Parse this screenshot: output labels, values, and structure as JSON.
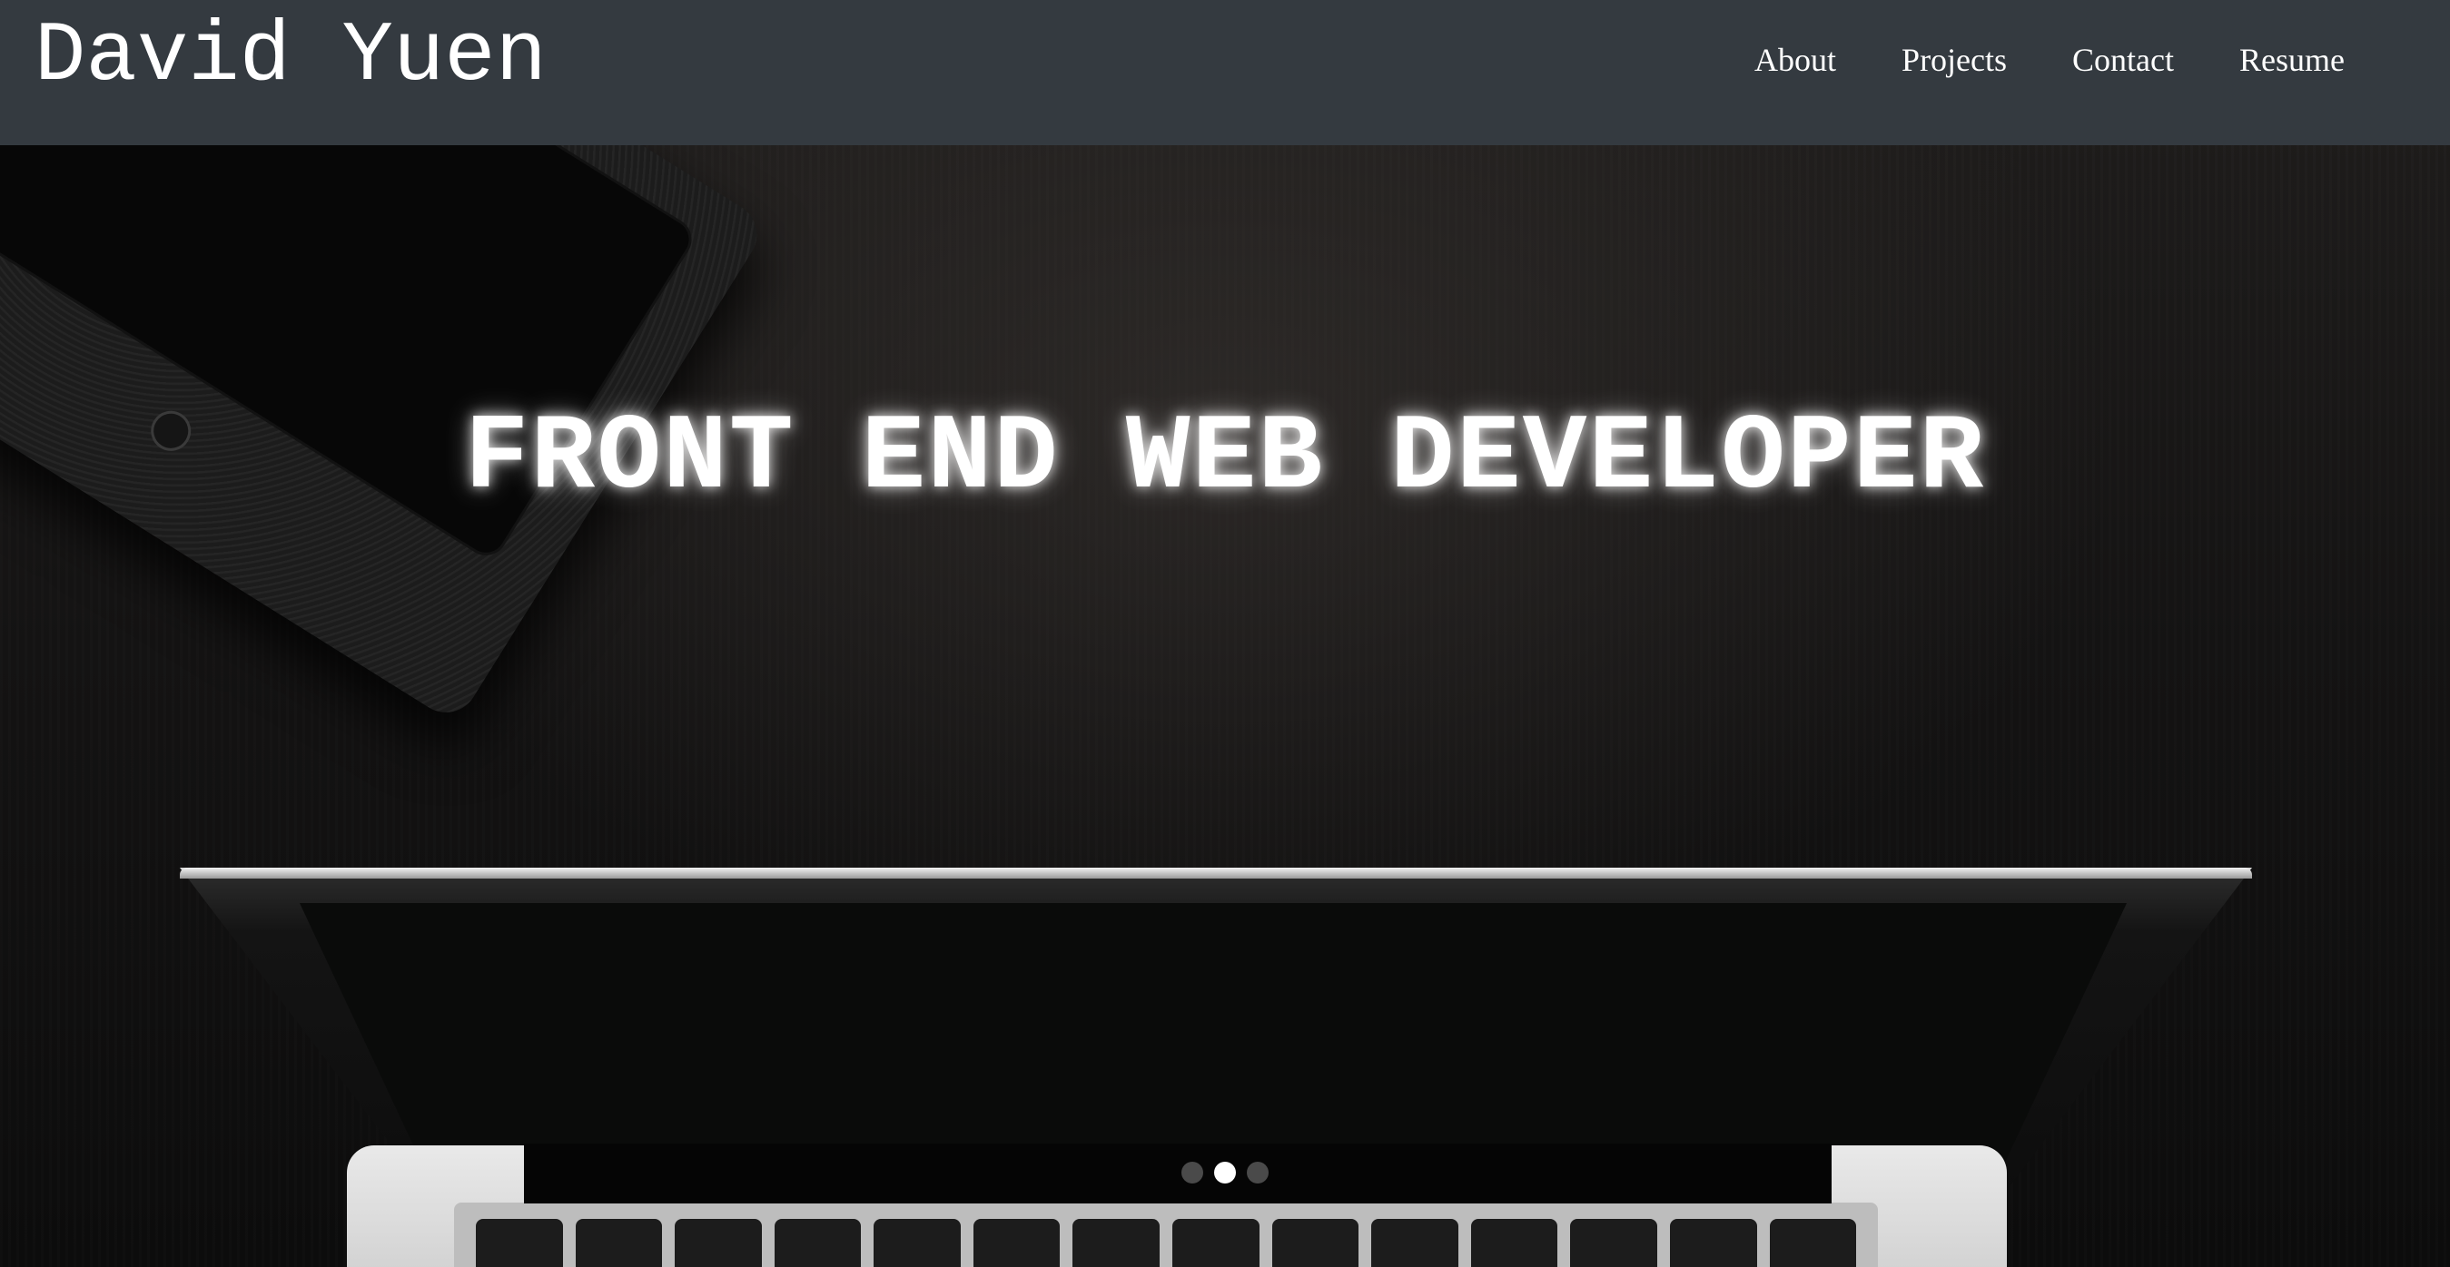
{
  "header": {
    "brand": "David Yuen",
    "nav": [
      {
        "label": "About"
      },
      {
        "label": "Projects"
      },
      {
        "label": "Contact"
      },
      {
        "label": "Resume"
      }
    ]
  },
  "hero": {
    "headline": "FRONT END WEB DEVELOPER",
    "carousel": {
      "slide_count": 3,
      "active_index": 1
    }
  },
  "colors": {
    "navbar_bg": "#343a40",
    "text": "#ffffff",
    "dot_inactive": "#4a4a4a",
    "dot_active": "#ffffff"
  }
}
